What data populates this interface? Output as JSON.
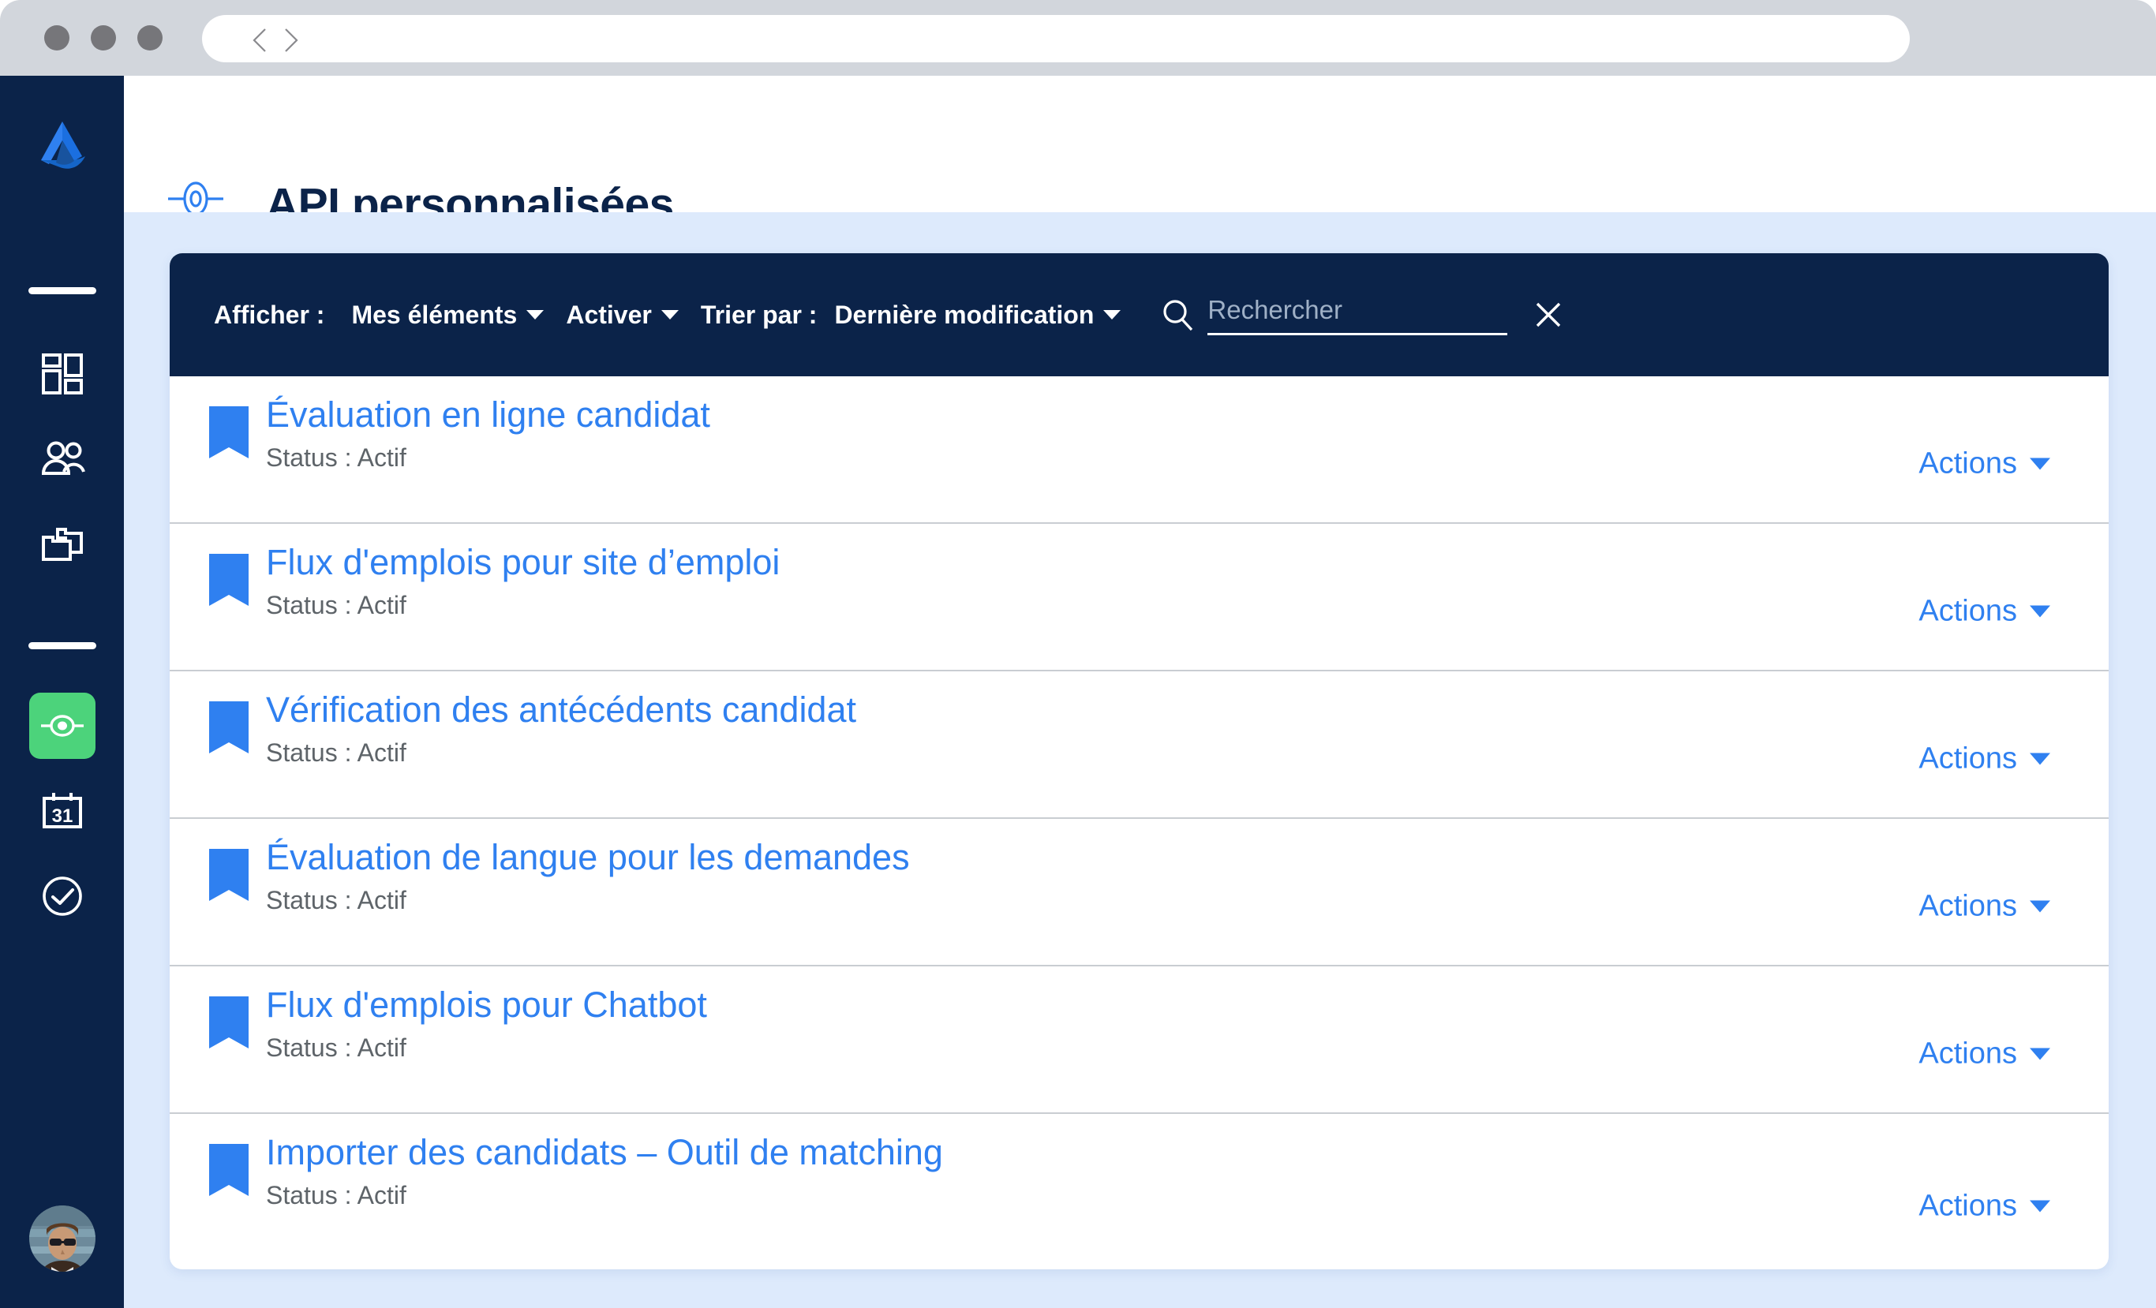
{
  "browser": {
    "nav_back_icon": "chevron-left-icon",
    "nav_forward_icon": "chevron-right-icon",
    "url_value": "",
    "url_placeholder": ""
  },
  "colors": {
    "sidebar_bg": "#0b2349",
    "toolbar_bg": "#0b2349",
    "content_bg": "#ddeafc",
    "accent_blue": "#2f80f0",
    "active_green": "#4cd37b",
    "title_navy": "#0b2349",
    "status_gray": "#5e6469"
  },
  "sidebar": {
    "logo_name": "app-logo",
    "items": [
      {
        "icon": "grid-dashboard-icon",
        "name": "sidebar-item-dashboard",
        "active": false
      },
      {
        "icon": "people-icon",
        "name": "sidebar-item-people",
        "active": false
      },
      {
        "icon": "folders-icon",
        "name": "sidebar-item-folders",
        "active": false
      },
      {
        "icon": "api-node-icon",
        "name": "sidebar-item-api",
        "active": true
      },
      {
        "icon": "calendar-31-icon",
        "name": "sidebar-item-calendar",
        "active": false,
        "day_number": "31"
      },
      {
        "icon": "check-circle-icon",
        "name": "sidebar-item-tasks",
        "active": false
      }
    ],
    "avatar_name": "user-avatar"
  },
  "header": {
    "icon": "api-node-icon",
    "title": "API personnalisées"
  },
  "toolbar": {
    "display_label": "Afficher :",
    "display_value": "Mes éléments",
    "activate_value": "Activer",
    "sort_label": "Trier par :",
    "sort_value": "Dernière modification",
    "search_placeholder": "Rechercher",
    "search_value": "",
    "search_icon": "search-icon",
    "clear_icon": "close-icon"
  },
  "list": {
    "status_prefix": "Status :",
    "actions_label": "Actions",
    "rows": [
      {
        "title": "Évaluation en ligne candidat",
        "status": "Status : Actif",
        "actions": "Actions"
      },
      {
        "title": "Flux d'emplois pour site d’emploi",
        "status": "Status : Actif",
        "actions": "Actions"
      },
      {
        "title": "Vérification des antécédents candidat",
        "status": "Status : Actif",
        "actions": "Actions"
      },
      {
        "title": "Évaluation de langue pour les demandes",
        "status": "Status : Actif",
        "actions": "Actions"
      },
      {
        "title": "Flux d'emplois pour Chatbot",
        "status": "Status : Actif",
        "actions": "Actions"
      },
      {
        "title": " Importer des candidats – Outil de matching",
        "status": "Status : Actif",
        "actions": "Actions"
      }
    ]
  }
}
